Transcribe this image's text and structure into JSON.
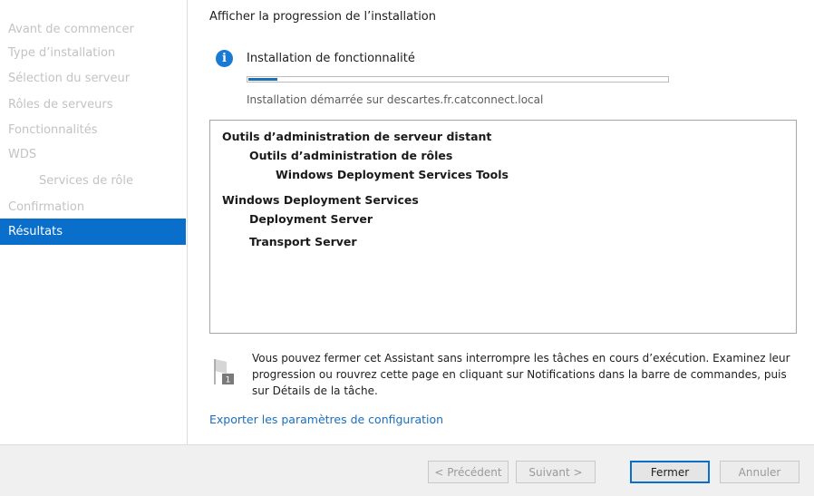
{
  "sidebar": {
    "items": [
      {
        "label": "Avant de commencer",
        "state": "disabled"
      },
      {
        "label": "Type d’installation",
        "state": "disabled"
      },
      {
        "label": "Sélection du serveur",
        "state": "disabled"
      },
      {
        "label": "Rôles de serveurs",
        "state": "disabled"
      },
      {
        "label": "Fonctionnalités",
        "state": "disabled"
      },
      {
        "label": "WDS",
        "state": "disabled"
      },
      {
        "label": "Services de rôle",
        "state": "disabled",
        "indent": true
      },
      {
        "label": "Confirmation",
        "state": "disabled"
      },
      {
        "label": "Résultats",
        "state": "active"
      }
    ]
  },
  "main": {
    "title": "Afficher la progression de l’installation",
    "status": {
      "icon": "info-icon",
      "icon_glyph": "i",
      "title": "Installation de fonctionnalité",
      "progress": 0.07,
      "subtitle": "Installation démarrée sur descartes.fr.catconnect.local"
    },
    "results_tree": [
      {
        "label": "Outils d’administration de serveur distant",
        "level": 0
      },
      {
        "label": "Outils d’administration de rôles",
        "level": 1
      },
      {
        "label": "Windows Deployment Services Tools",
        "level": 2
      },
      {
        "label": "Windows Deployment Services",
        "level": 0
      },
      {
        "label": "Deployment Server",
        "level": 1
      },
      {
        "label": "Transport Server",
        "level": 1
      }
    ],
    "note": {
      "icon": "flag-notification-icon",
      "badge": "1",
      "text": "Vous pouvez fermer cet Assistant sans interrompre les tâches en cours d’exécution. Examinez leur progression ou rouvrez cette page en cliquant sur Notifications dans la barre de commandes, puis sur Détails de la tâche."
    },
    "export_link": "Exporter les paramètres de configuration"
  },
  "footer": {
    "buttons": {
      "previous": "< Précédent",
      "next": "Suivant >",
      "close": "Fermer",
      "cancel": "Annuler"
    }
  },
  "colors": {
    "accent": "#0a6fcb",
    "link": "#1b6ebb",
    "progress": "#1f6fb6",
    "disabled_text": "#c3c3c3"
  }
}
